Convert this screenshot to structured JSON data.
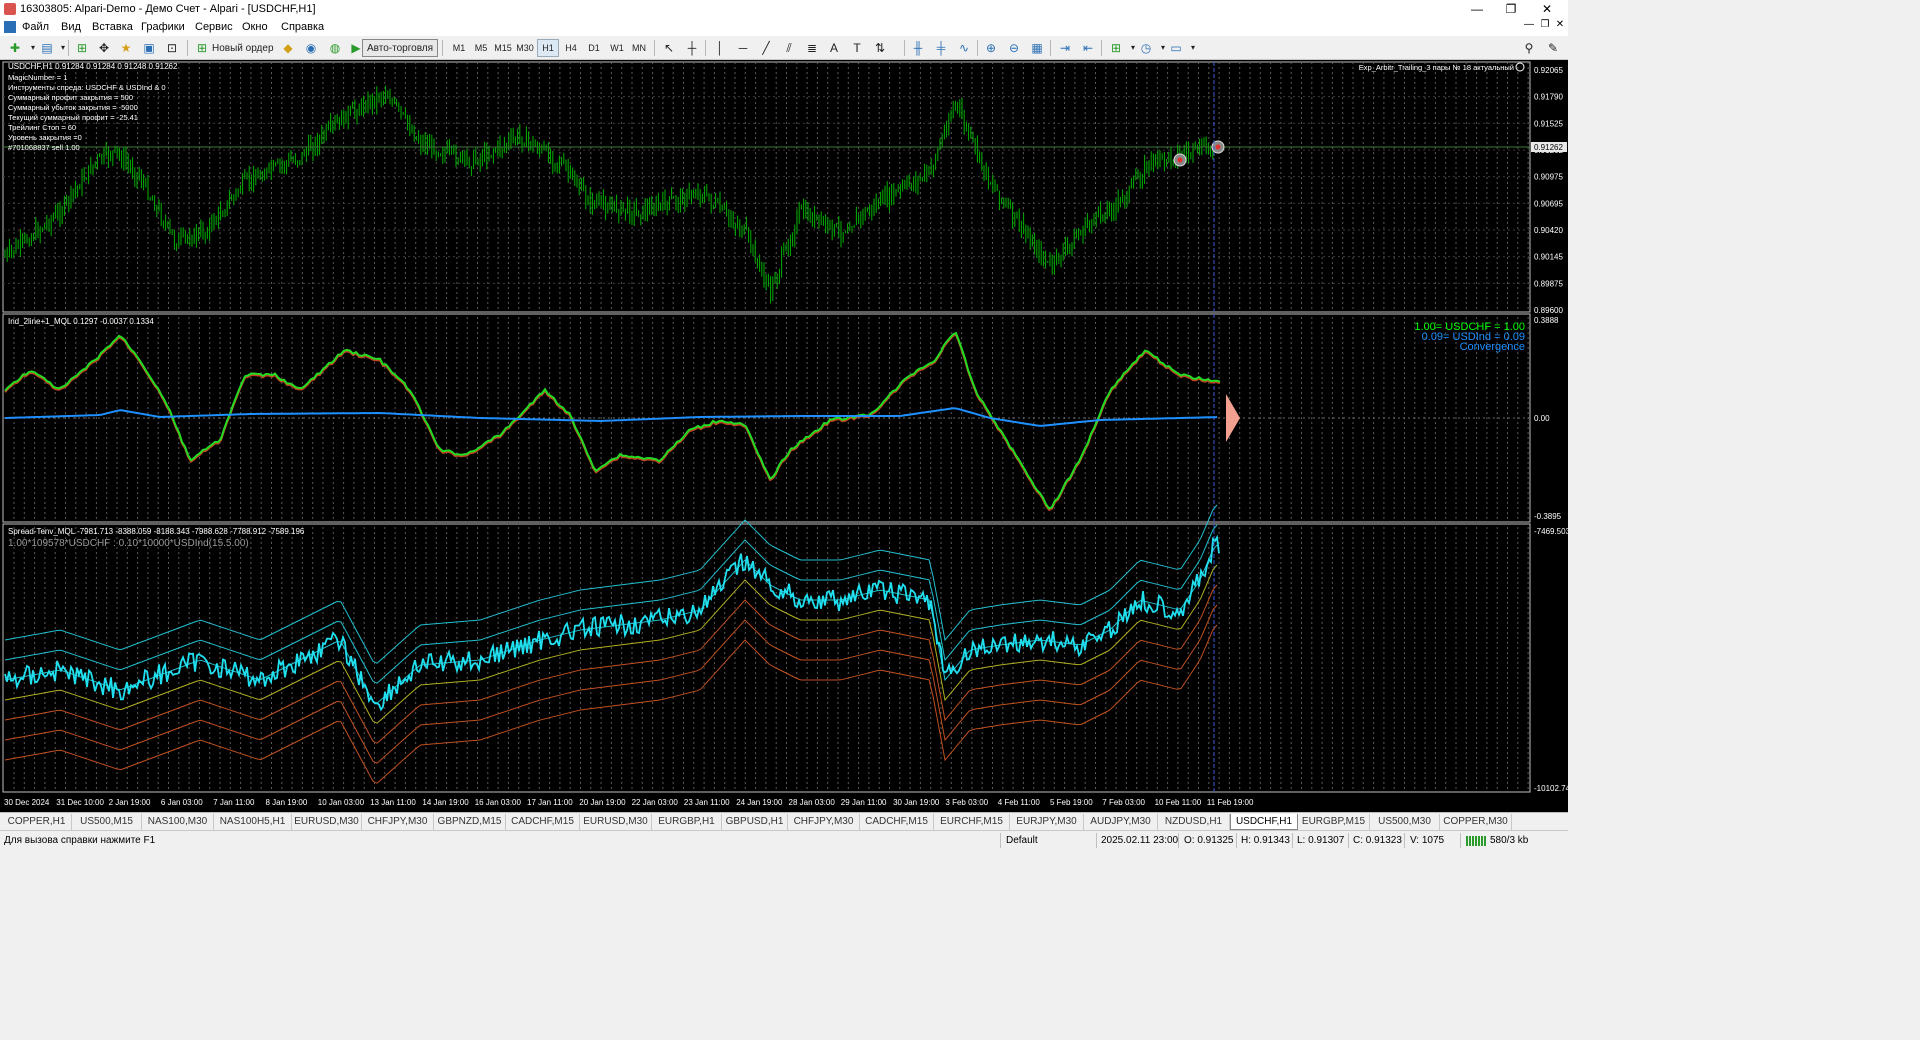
{
  "window": {
    "title": "16303805: Alpari-Demo - Демо Счет - Alpari - [USDCHF,H1]",
    "minimize": "—",
    "restore": "❐",
    "close": "✕"
  },
  "menu": {
    "items": [
      "Файл",
      "Вид",
      "Вставка",
      "Графики",
      "Сервис",
      "Окно",
      "Справка"
    ],
    "mdi_min": "—",
    "mdi_restore": "❐",
    "mdi_close": "✕"
  },
  "toolbar": {
    "new_order": "Новый ордер",
    "auto_trading": "Авто-торговля",
    "timeframes": [
      "M1",
      "M5",
      "M15",
      "M30",
      "H1",
      "H4",
      "D1",
      "W1",
      "MN"
    ],
    "active_timeframe": "H1"
  },
  "main_chart": {
    "header": "USDCHF,H1  0.91284 0.91284 0.91248 0.91262",
    "info_lines": [
      "MagicNumber = 1",
      "Инструменты спреда: USDCHF & USDInd & 0",
      "Суммарный профит закрытия = 500",
      "Суммарный убыток закрытия = -5000",
      "Текущий суммарный профит = -25.41",
      "Трейлинг Стоп = 60",
      "Уровень закрытия =0",
      "#701068837 sell 1.00"
    ],
    "ea_label": "Exp_Arbitr_Trailing_3 пары № 18 актуальный",
    "price_labels": [
      "0.92065",
      "0.91790",
      "0.91525",
      "0.91262",
      "0.90975",
      "0.90695",
      "0.90420",
      "0.90145",
      "0.89875",
      "0.89600"
    ],
    "current_price": "0.91262",
    "colors": {
      "candles": "#00b000",
      "price_line": "#3a7a3a",
      "current_price_bg": "#e8e8e8"
    }
  },
  "indicator1": {
    "header": "Ind_2line+1_MQL 0.1297 -0.0037 0.1334",
    "legend": [
      "1.00= USDCHF = 1.00",
      "0.09= USDInd = 0.09",
      "Convergence"
    ],
    "legend_colors": [
      "#00ff00",
      "#1e90ff",
      "#1e90ff"
    ],
    "scale": [
      "0.3888",
      "0.00",
      "-0.3895"
    ]
  },
  "indicator2": {
    "header": "Spread-Tenv_MQL -7981.713 -8388.059 -8188.343 -7988.628 -7788.912 -7589.196",
    "formula": "1.00*109578*USDCHF : 0.10*10000*USDInd(15.5.00)",
    "scale": [
      "-7469.503",
      "-10102.74"
    ]
  },
  "time_axis": [
    "30 Dec 2024",
    "31 Dec 10:00",
    "2 Jan 19:00",
    "6 Jan 03:00",
    "7 Jan 11:00",
    "8 Jan 19:00",
    "10 Jan 03:00",
    "13 Jan 11:00",
    "14 Jan 19:00",
    "16 Jan 03:00",
    "17 Jan 11:00",
    "20 Jan 19:00",
    "22 Jan 03:00",
    "23 Jan 11:00",
    "24 Jan 19:00",
    "28 Jan 03:00",
    "29 Jan 11:00",
    "30 Jan 19:00",
    "3 Feb 03:00",
    "4 Feb 11:00",
    "5 Feb 19:00",
    "7 Feb 03:00",
    "10 Feb 11:00",
    "11 Feb 19:00"
  ],
  "tabs": [
    "COPPER,H1",
    "US500,M15",
    "NAS100,M30",
    "NAS100H5,H1",
    "EURUSD,M30",
    "CHFJPY,M30",
    "GBPNZD,M15",
    "CADCHF,M15",
    "EURUSD,M30",
    "EURGBP,H1",
    "GBPUSD,H1",
    "CHFJPY,M30",
    "CADCHF,M15",
    "EURCHF,M15",
    "EURJPY,M30",
    "AUDJPY,M30",
    "NZDUSD,H1",
    "USDCHF,H1",
    "EURGBP,M15",
    "US500,M30",
    "COPPER,M30"
  ],
  "active_tab": "USDCHF,H1",
  "status": {
    "help": "Для вызова справки нажмите F1",
    "profile": "Default",
    "datetime": "2025.02.11 23:00",
    "open": "O: 0.91325",
    "high": "H: 0.91343",
    "low": "L: 0.91307",
    "close": "C: 0.91323",
    "volume": "V: 1075",
    "traffic": "580/3 kb"
  }
}
